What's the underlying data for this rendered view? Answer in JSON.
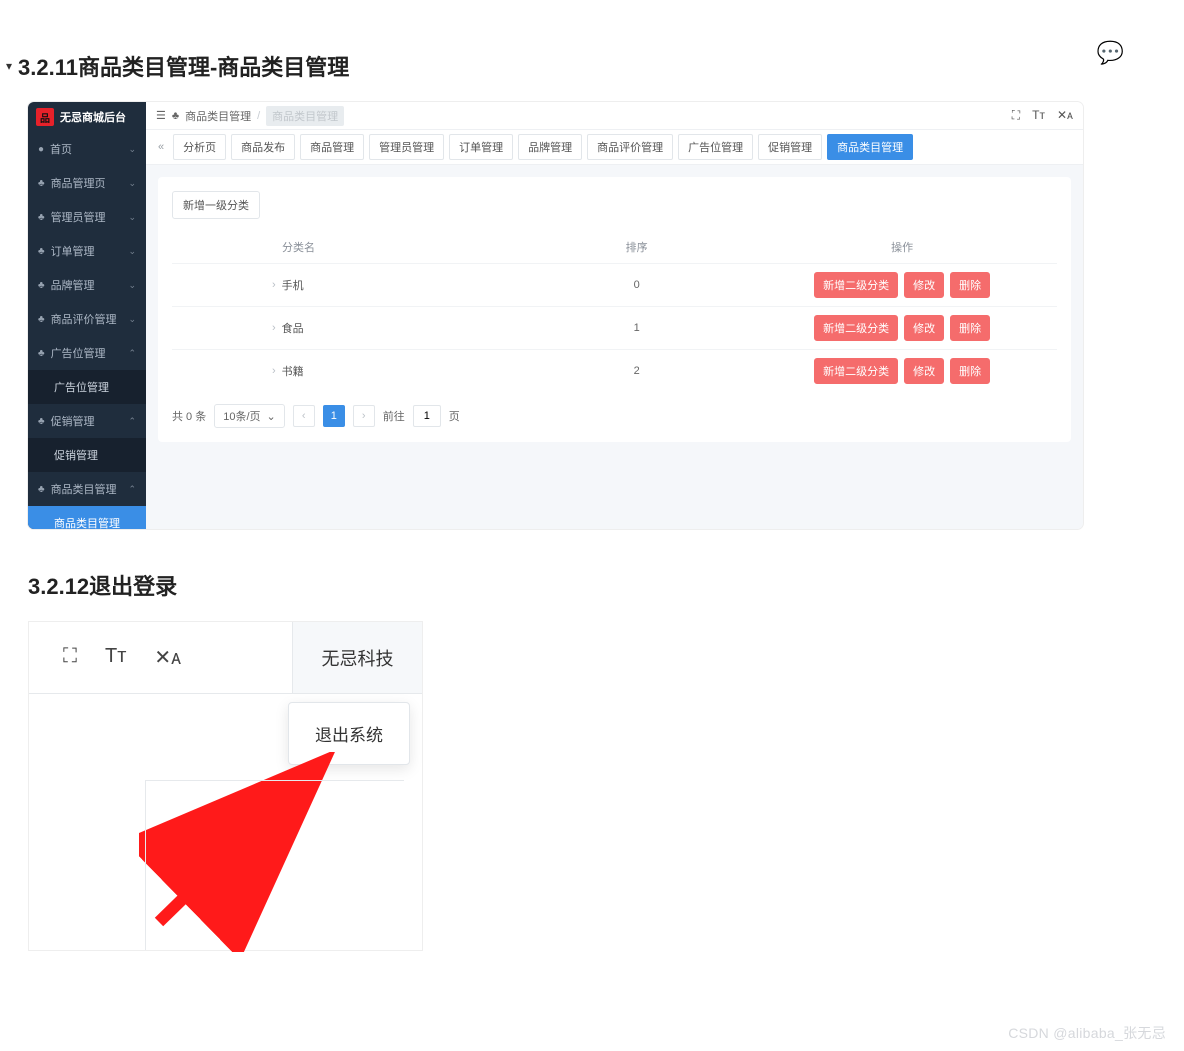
{
  "doc": {
    "section1_title": "3.2.11商品类目管理-商品类目管理",
    "section2_title": "3.2.12退出登录"
  },
  "sidebar": {
    "brand": "无忌商城后台",
    "items": [
      {
        "icon": "●",
        "label": "首页",
        "chev": "⌄"
      },
      {
        "icon": "♣",
        "label": "商品管理页",
        "chev": "⌄"
      },
      {
        "icon": "♣",
        "label": "管理员管理",
        "chev": "⌄"
      },
      {
        "icon": "♣",
        "label": "订单管理",
        "chev": "⌄"
      },
      {
        "icon": "♣",
        "label": "品牌管理",
        "chev": "⌄"
      },
      {
        "icon": "♣",
        "label": "商品评价管理",
        "chev": "⌄"
      },
      {
        "icon": "♣",
        "label": "广告位管理",
        "chev": "⌃",
        "sub": "广告位管理"
      },
      {
        "icon": "♣",
        "label": "促销管理",
        "chev": "⌃",
        "sub": "促销管理"
      },
      {
        "icon": "♣",
        "label": "商品类目管理",
        "chev": "⌃",
        "sub": "商品类目管理",
        "active": true
      }
    ]
  },
  "breadcrumb": {
    "toggle": "☰",
    "icon": "♣",
    "root": "商品类目管理",
    "sep": "/",
    "current": "商品类目管理",
    "right_icons": [
      "⛶",
      "Tᴛ",
      "✕ᴀ"
    ]
  },
  "tabs": {
    "collapse": "«",
    "items": [
      "分析页",
      "商品发布",
      "商品管理",
      "管理员管理",
      "订单管理",
      "品牌管理",
      "商品评价管理",
      "广告位管理",
      "促销管理",
      "商品类目管理"
    ],
    "active_index": 9
  },
  "panel": {
    "add_btn": "新增一级分类",
    "headers": {
      "name": "分类名",
      "sort": "排序",
      "action": "操作"
    },
    "rows": [
      {
        "name": "手机",
        "sort": "0"
      },
      {
        "name": "食品",
        "sort": "1"
      },
      {
        "name": "书籍",
        "sort": "2"
      }
    ],
    "row_actions": [
      "新增二级分类",
      "修改",
      "删除"
    ],
    "pager": {
      "total": "共 0 条",
      "per": "10条/页",
      "prev": "‹",
      "cur": "1",
      "next": "›",
      "goto_label": "前往",
      "goto_val": "1",
      "page_suffix": "页"
    }
  },
  "logout": {
    "icons": [
      "⛶",
      "Tᴛ",
      "✕ᴀ"
    ],
    "user": "无忌科技",
    "menu_item": "退出系统"
  },
  "watermark": "CSDN @alibaba_张无忌"
}
